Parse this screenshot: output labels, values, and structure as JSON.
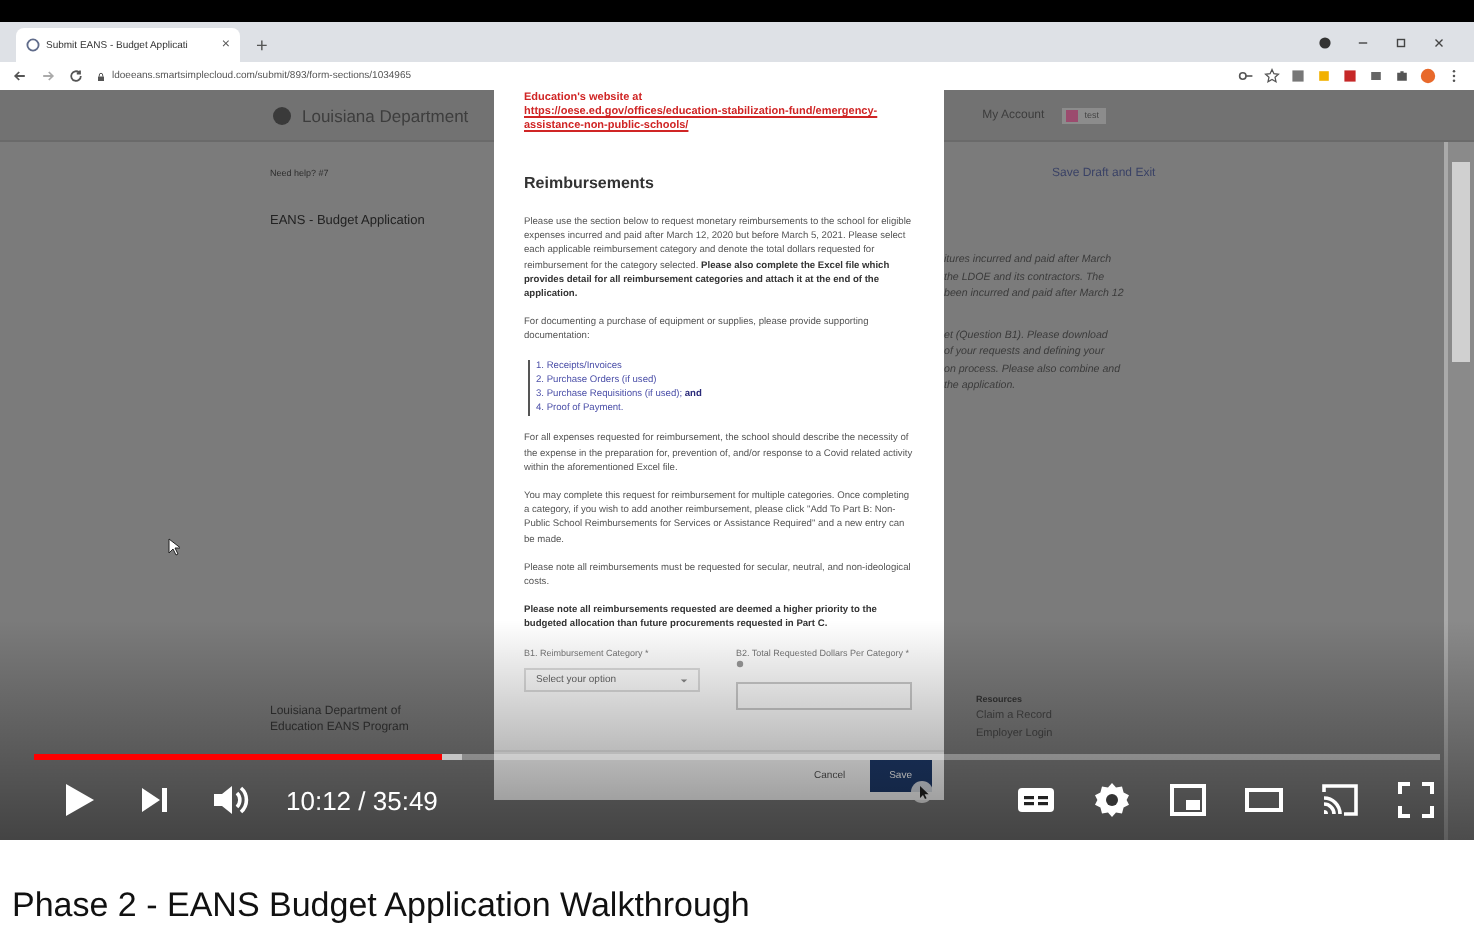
{
  "browser": {
    "tab": {
      "title": "Submit EANS - Budget Applicati",
      "close": "×"
    },
    "new_tab": "+",
    "url": "ldoeeans.smartsimplecloud.com/submit/893/form-sections/1034965"
  },
  "page": {
    "header": {
      "org": "Louisiana Department",
      "account": "My Account",
      "user": "test"
    },
    "help": "Need help? #7",
    "heading": "EANS - Budget Application",
    "save_draft": "Save Draft and Exit",
    "right_text": [
      "itures incurred and paid after March",
      "the LDOE and its contractors. The",
      "been incurred and paid after March 12"
    ],
    "right_text_2": [
      "et (Question B1). Please download",
      "of your requests and defining your",
      "on process. Please also combine and",
      "the application."
    ],
    "footer_left": [
      "Louisiana Department of",
      "Education EANS Program"
    ],
    "resources": {
      "title": "Resources",
      "links": [
        "Claim a Record",
        "Employer Login"
      ]
    }
  },
  "modal": {
    "intro": "Education's website at ",
    "link": "https://oese.ed.gov/offices/education-stabilization-fund/emergency-assistance-non-public-schools/",
    "title": "Reimbursements",
    "blocks": [
      {
        "kind": "paragraph",
        "text": "Please use the section below to request monetary reimbursements to the school for eligible expenses incurred and paid after March 12, 2020 but before March 5, 2021. Please select each applicable reimbursement category and denote the total dollars requested for reimbursement for the category selected. **Please also complete the Excel file which provides detail for all reimbursement categories and attach it at the end of the application.**"
      },
      {
        "kind": "paragraph",
        "text": "For documenting a purchase of equipment or supplies, please provide supporting documentation:"
      },
      {
        "kind": "list",
        "items": [
          "1. Receipts/Invoices",
          "2. Purchase Orders (if used)",
          "3. Purchase Requisitions (if used); **and**",
          "4. Proof of Payment."
        ]
      },
      {
        "kind": "paragraph",
        "text": "For all expenses requested for reimbursement, the school should describe the necessity of the expense in the preparation for, prevention of, and/or response to a Covid related activity within the aforementioned Excel file."
      },
      {
        "kind": "paragraph",
        "text": "You may complete this request for reimbursement for multiple categories. Once completing a category, if you wish to add another reimbursement, please click \"Add To Part B: Non-Public School Reimbursements for Services or Assistance Required\" and a new entry can be made."
      },
      {
        "kind": "paragraph",
        "text": "Please note all reimbursements must be requested for secular, neutral, and non-ideological costs."
      },
      {
        "kind": "bold",
        "text": "Please note all reimbursements requested are deemed a higher priority to the budgeted allocation than future procurements requested in Part C."
      }
    ],
    "fields": [
      {
        "kind": "select",
        "label": "B1. Reimbursement Category *",
        "placeholder": "Select your option"
      },
      {
        "kind": "input",
        "label": "B2. Total Requested Dollars Per Category *"
      }
    ],
    "buttons": [
      {
        "kind": "secondary",
        "label": "Cancel"
      },
      {
        "kind": "primary",
        "label": "Save"
      }
    ]
  },
  "player": {
    "progress": {
      "level": 0.29
    },
    "time": "10:12 / 35:49"
  },
  "video_title": "Phase 2 - EANS Budget Application Walkthrough"
}
